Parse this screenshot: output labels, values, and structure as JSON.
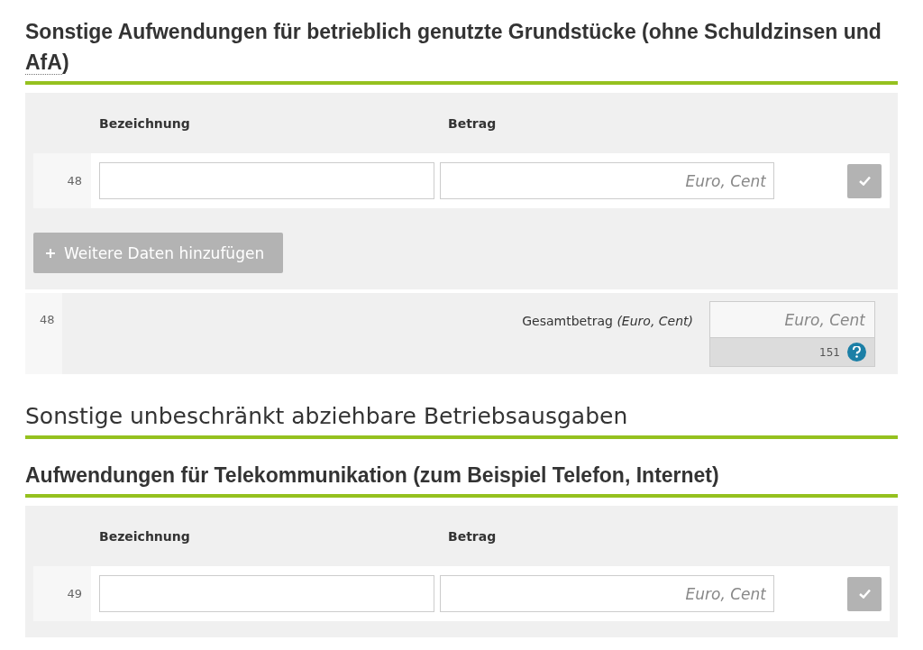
{
  "blocks": [
    {
      "kind": "subheading",
      "parts": [
        {
          "text": "Sonstige Aufwendungen für betrieblich genutzte Grundstücke (ohne Schuldzinsen und "
        },
        {
          "text": "AfA",
          "abbr": true
        },
        {
          "text": ")"
        }
      ]
    },
    {
      "kind": "table",
      "columns": [
        "Bezeichnung",
        "Betrag"
      ],
      "rows": [
        {
          "line": "48",
          "name_value": "",
          "amount_placeholder": "Euro, Cent"
        }
      ],
      "add_button": "Weitere Daten hinzufügen"
    },
    {
      "kind": "total",
      "line": "48",
      "label": "Gesamtbetrag *(Euro, Cent)*",
      "placeholder": "Euro, Cent",
      "code": "151"
    },
    {
      "kind": "heading",
      "parts": [
        {
          "text": "Sonstige unbeschränkt abziehbare Betriebsausgaben"
        }
      ]
    },
    {
      "kind": "subheading",
      "parts": [
        {
          "text": "Aufwendungen für Telekommunikation (zum Beispiel Telefon, Internet)"
        }
      ]
    },
    {
      "kind": "table",
      "columns": [
        "Bezeichnung",
        "Betrag"
      ],
      "rows": [
        {
          "line": "49",
          "name_value": "",
          "amount_placeholder": "Euro, Cent"
        }
      ]
    }
  ]
}
